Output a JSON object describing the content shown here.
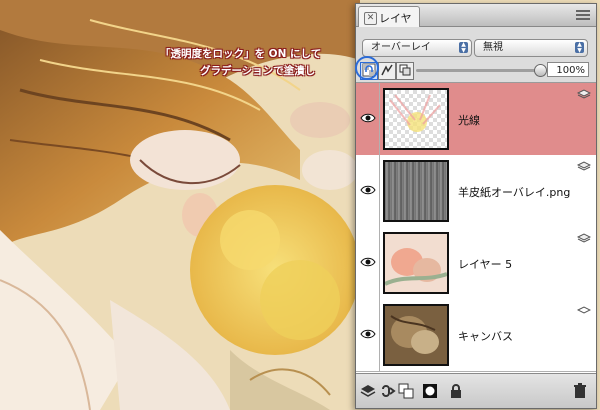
{
  "panel": {
    "tab_label": "レイヤー",
    "blend_mode": "オーバーレイ",
    "ignore_option": "無視",
    "opacity": "100%"
  },
  "layers": [
    {
      "name": "光線",
      "selected": true
    },
    {
      "name": "羊皮紙オーバレイ.png",
      "selected": false
    },
    {
      "name": "レイヤー 5",
      "selected": false
    },
    {
      "name": "キャンバス",
      "selected": false
    }
  ],
  "annotation": {
    "line1": "「透明度をロック」を ON にして",
    "line2": "グラデーションで塗潰し"
  },
  "colors": {
    "selected_row": "#e08c8c",
    "annotation_text": "#8a1c1c",
    "highlight": "#2a6bd8"
  }
}
